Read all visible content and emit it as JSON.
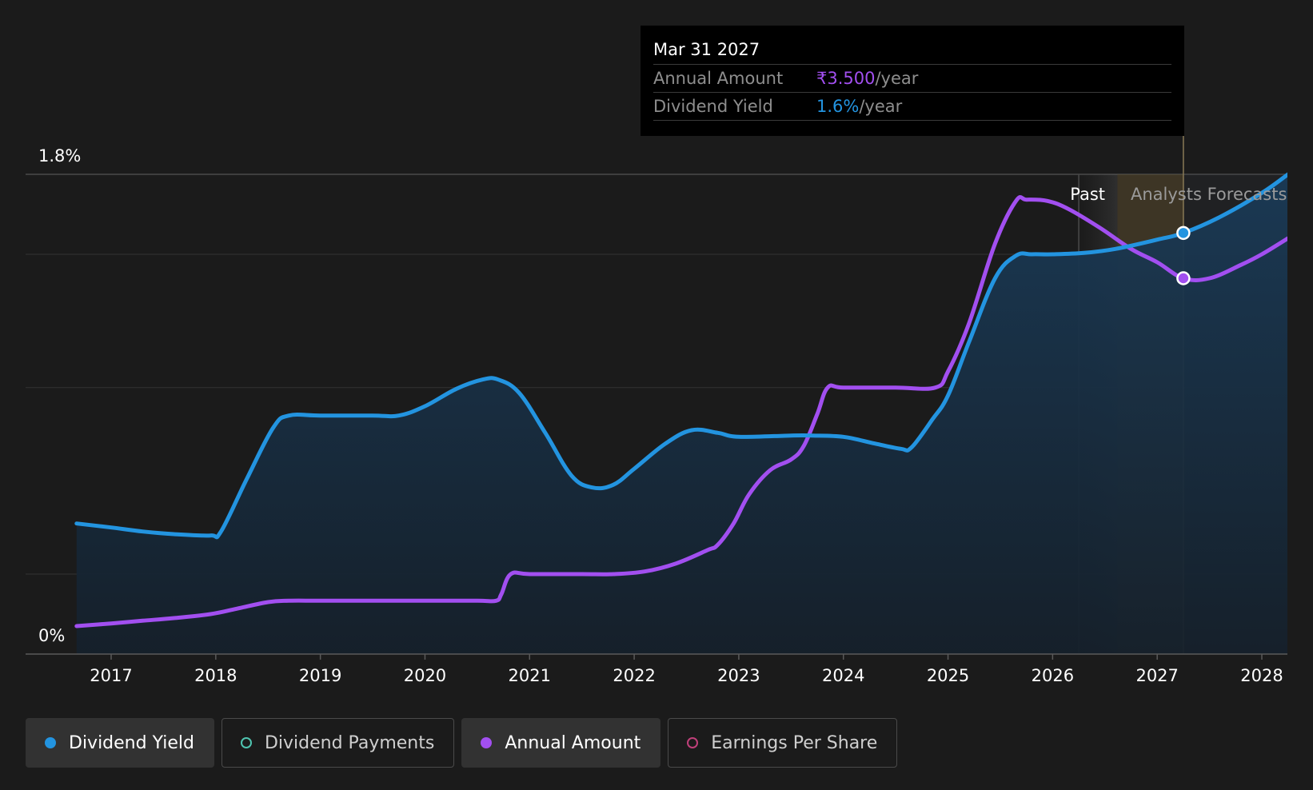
{
  "tooltip": {
    "date": "Mar 31 2027",
    "rows": [
      {
        "label": "Annual Amount",
        "value": "₹3.500",
        "unit": "/year",
        "color": "#a24ff0"
      },
      {
        "label": "Dividend Yield",
        "value": "1.6%",
        "unit": "/year",
        "color": "#2394e0"
      }
    ]
  },
  "legend": [
    {
      "label": "Dividend Yield",
      "color": "#2394e0",
      "filled": true,
      "active": true
    },
    {
      "label": "Dividend Payments",
      "color": "#4fc4b0",
      "filled": false,
      "active": false
    },
    {
      "label": "Annual Amount",
      "color": "#a24ff0",
      "filled": true,
      "active": true
    },
    {
      "label": "Earnings Per Share",
      "color": "#c0407a",
      "filled": false,
      "active": false
    }
  ],
  "chart_data": {
    "type": "line",
    "y_top_label": "1.8%",
    "y_bottom_label": "0%",
    "ylim": [
      0,
      1.8
    ],
    "xlim": [
      2016.67,
      2028.25
    ],
    "x_ticks": [
      "2017",
      "2018",
      "2019",
      "2020",
      "2021",
      "2022",
      "2023",
      "2024",
      "2025",
      "2026",
      "2027",
      "2028"
    ],
    "past_label": "Past",
    "forecast_label": "Analysts Forecasts",
    "past_end": 2026.25,
    "forecast_start": 2026.62,
    "hover_x": 2027.25,
    "grid": true,
    "series": [
      {
        "name": "Dividend Yield",
        "color": "#2394e0",
        "unit": "%",
        "points": [
          [
            2016.67,
            0.49
          ],
          [
            2017.0,
            0.475
          ],
          [
            2017.3,
            0.46
          ],
          [
            2017.6,
            0.45
          ],
          [
            2017.95,
            0.445
          ],
          [
            2018.05,
            0.46
          ],
          [
            2018.3,
            0.66
          ],
          [
            2018.55,
            0.85
          ],
          [
            2018.7,
            0.895
          ],
          [
            2019.0,
            0.895
          ],
          [
            2019.5,
            0.895
          ],
          [
            2019.75,
            0.895
          ],
          [
            2020.0,
            0.93
          ],
          [
            2020.3,
            0.995
          ],
          [
            2020.55,
            1.03
          ],
          [
            2020.7,
            1.03
          ],
          [
            2020.9,
            0.98
          ],
          [
            2021.15,
            0.83
          ],
          [
            2021.4,
            0.67
          ],
          [
            2021.6,
            0.625
          ],
          [
            2021.8,
            0.635
          ],
          [
            2022.0,
            0.695
          ],
          [
            2022.3,
            0.79
          ],
          [
            2022.55,
            0.84
          ],
          [
            2022.8,
            0.83
          ],
          [
            2023.0,
            0.815
          ],
          [
            2023.5,
            0.82
          ],
          [
            2023.7,
            0.82
          ],
          [
            2024.0,
            0.815
          ],
          [
            2024.3,
            0.79
          ],
          [
            2024.55,
            0.77
          ],
          [
            2024.65,
            0.775
          ],
          [
            2024.85,
            0.88
          ],
          [
            2025.0,
            0.97
          ],
          [
            2025.2,
            1.17
          ],
          [
            2025.45,
            1.41
          ],
          [
            2025.65,
            1.495
          ],
          [
            2025.8,
            1.5
          ],
          [
            2026.0,
            1.5
          ],
          [
            2026.3,
            1.505
          ],
          [
            2026.6,
            1.52
          ],
          [
            2027.0,
            1.555
          ],
          [
            2027.25,
            1.58
          ],
          [
            2027.6,
            1.64
          ],
          [
            2028.0,
            1.73
          ],
          [
            2028.25,
            1.8
          ]
        ]
      },
      {
        "name": "Annual Amount",
        "color": "#a24ff0",
        "unit": "₹",
        "points": [
          [
            2016.67,
            0.105
          ],
          [
            2017.0,
            0.115
          ],
          [
            2017.3,
            0.125
          ],
          [
            2017.6,
            0.135
          ],
          [
            2017.95,
            0.15
          ],
          [
            2018.2,
            0.17
          ],
          [
            2018.5,
            0.195
          ],
          [
            2018.7,
            0.2
          ],
          [
            2019.0,
            0.2
          ],
          [
            2019.5,
            0.2
          ],
          [
            2020.0,
            0.2
          ],
          [
            2020.5,
            0.2
          ],
          [
            2020.68,
            0.2
          ],
          [
            2020.73,
            0.225
          ],
          [
            2020.82,
            0.3
          ],
          [
            2021.0,
            0.3
          ],
          [
            2021.5,
            0.3
          ],
          [
            2021.8,
            0.3
          ],
          [
            2022.1,
            0.31
          ],
          [
            2022.4,
            0.34
          ],
          [
            2022.7,
            0.39
          ],
          [
            2022.8,
            0.41
          ],
          [
            2022.95,
            0.49
          ],
          [
            2023.1,
            0.6
          ],
          [
            2023.3,
            0.69
          ],
          [
            2023.5,
            0.73
          ],
          [
            2023.62,
            0.78
          ],
          [
            2023.75,
            0.9
          ],
          [
            2023.85,
            1.0
          ],
          [
            2024.0,
            1.0
          ],
          [
            2024.5,
            1.0
          ],
          [
            2024.88,
            1.0
          ],
          [
            2025.0,
            1.06
          ],
          [
            2025.2,
            1.24
          ],
          [
            2025.45,
            1.54
          ],
          [
            2025.65,
            1.7
          ],
          [
            2025.75,
            1.705
          ],
          [
            2025.95,
            1.7
          ],
          [
            2026.15,
            1.67
          ],
          [
            2026.45,
            1.6
          ],
          [
            2026.75,
            1.52
          ],
          [
            2027.0,
            1.47
          ],
          [
            2027.25,
            1.41
          ],
          [
            2027.5,
            1.41
          ],
          [
            2027.8,
            1.46
          ],
          [
            2028.0,
            1.5
          ],
          [
            2028.25,
            1.56
          ]
        ]
      }
    ]
  }
}
